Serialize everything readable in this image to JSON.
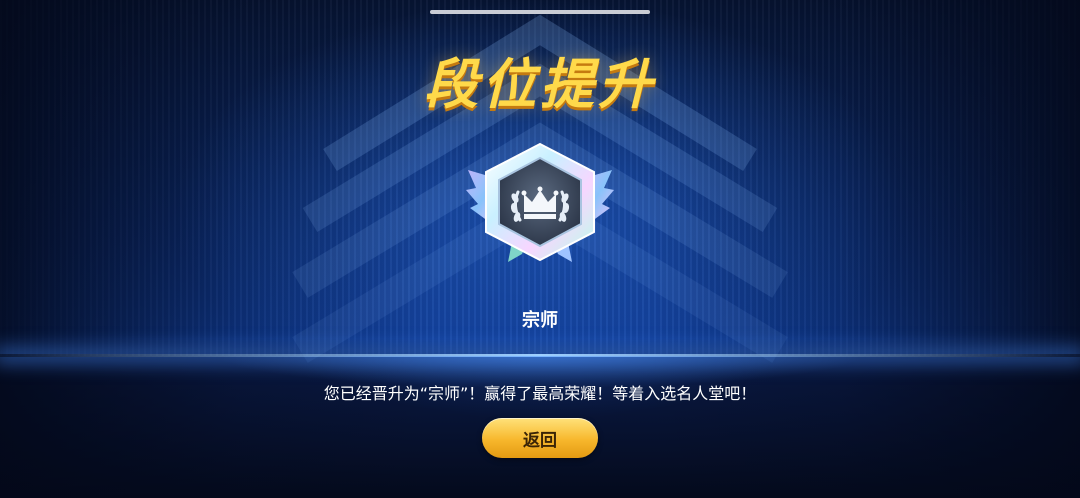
{
  "title": "段位提升",
  "rank": {
    "name": "宗师",
    "icon": "grandmaster-crown-badge-icon"
  },
  "message": "您已经晋升为“宗师”！赢得了最高荣耀！等着入选名人堂吧！",
  "return_button": {
    "label": "返回"
  },
  "colors": {
    "title_gold": "#ffd94a",
    "button_gold": "#f7b72c",
    "background_blue": "#0f3a92"
  }
}
